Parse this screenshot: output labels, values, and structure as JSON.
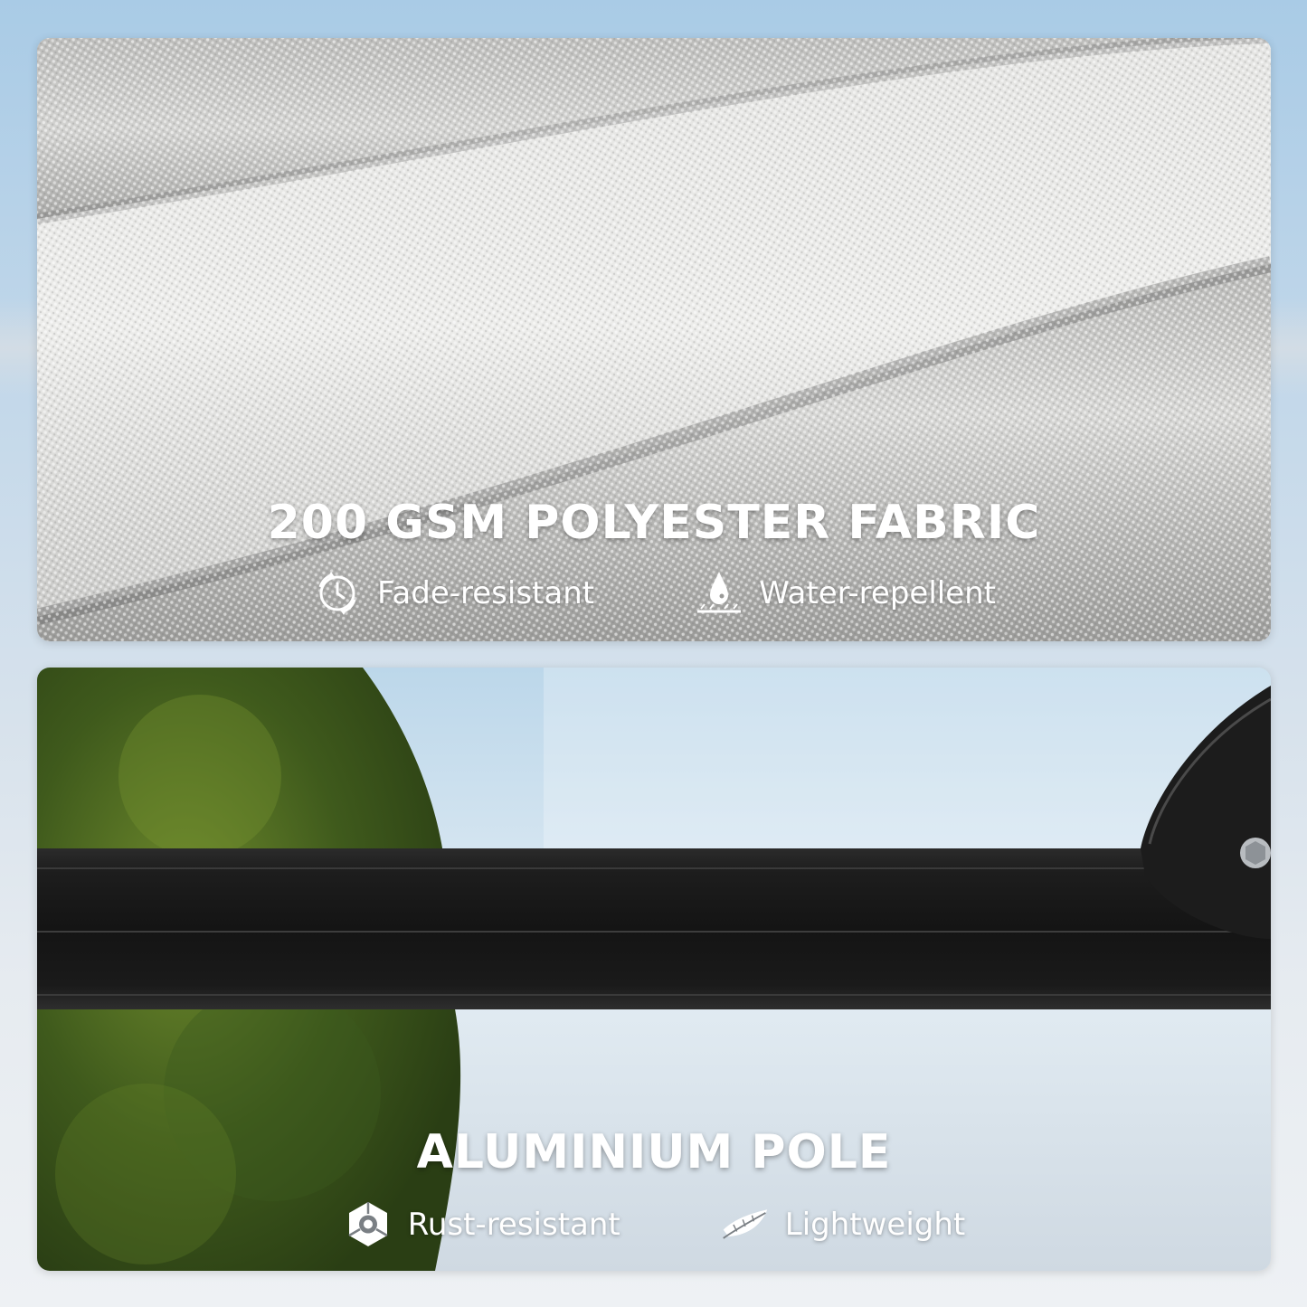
{
  "fabric_section": {
    "title": "200 GSM POLYESTER FABRIC",
    "features": [
      {
        "label": "Fade-resistant",
        "icon": "fade-resistant-icon"
      },
      {
        "label": "Water-repellent",
        "icon": "water-repellent-icon"
      }
    ]
  },
  "pole_section": {
    "title": "ALUMINIUM POLE",
    "features": [
      {
        "label": "Rust-resistant",
        "icon": "rust-resistant-icon"
      },
      {
        "label": "Lightweight",
        "icon": "feather-icon"
      }
    ]
  }
}
